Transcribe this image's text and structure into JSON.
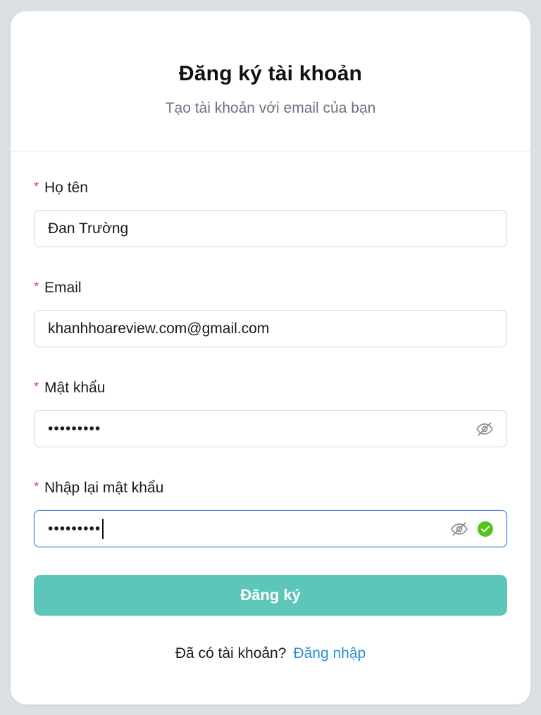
{
  "header": {
    "title": "Đăng ký tài khoản",
    "subtitle": "Tạo tài khoản với email của bạn"
  },
  "fields": [
    {
      "label": "Họ tên",
      "required_mark": "*",
      "value": "Đan Trường"
    },
    {
      "label": "Email",
      "required_mark": "*",
      "value": "khanhhoareview.com@gmail.com"
    },
    {
      "label": "Mật khẩu",
      "required_mark": "*",
      "value": "•••••••••"
    },
    {
      "label": "Nhập lại mật khẩu",
      "required_mark": "*",
      "value": "•••••••••"
    }
  ],
  "submit_label": "Đăng ký",
  "footer": {
    "prompt": "Đã có tài khoản?",
    "login_link": "Đăng nhập"
  },
  "icons": {
    "toggle_visibility": "eye-off-icon",
    "valid": "check-circle-icon"
  },
  "colors": {
    "accent": "#5cc6b8",
    "link": "#2d8fd5",
    "required": "#e5484d",
    "focus": "#2f6fe0",
    "success": "#52c41a"
  }
}
